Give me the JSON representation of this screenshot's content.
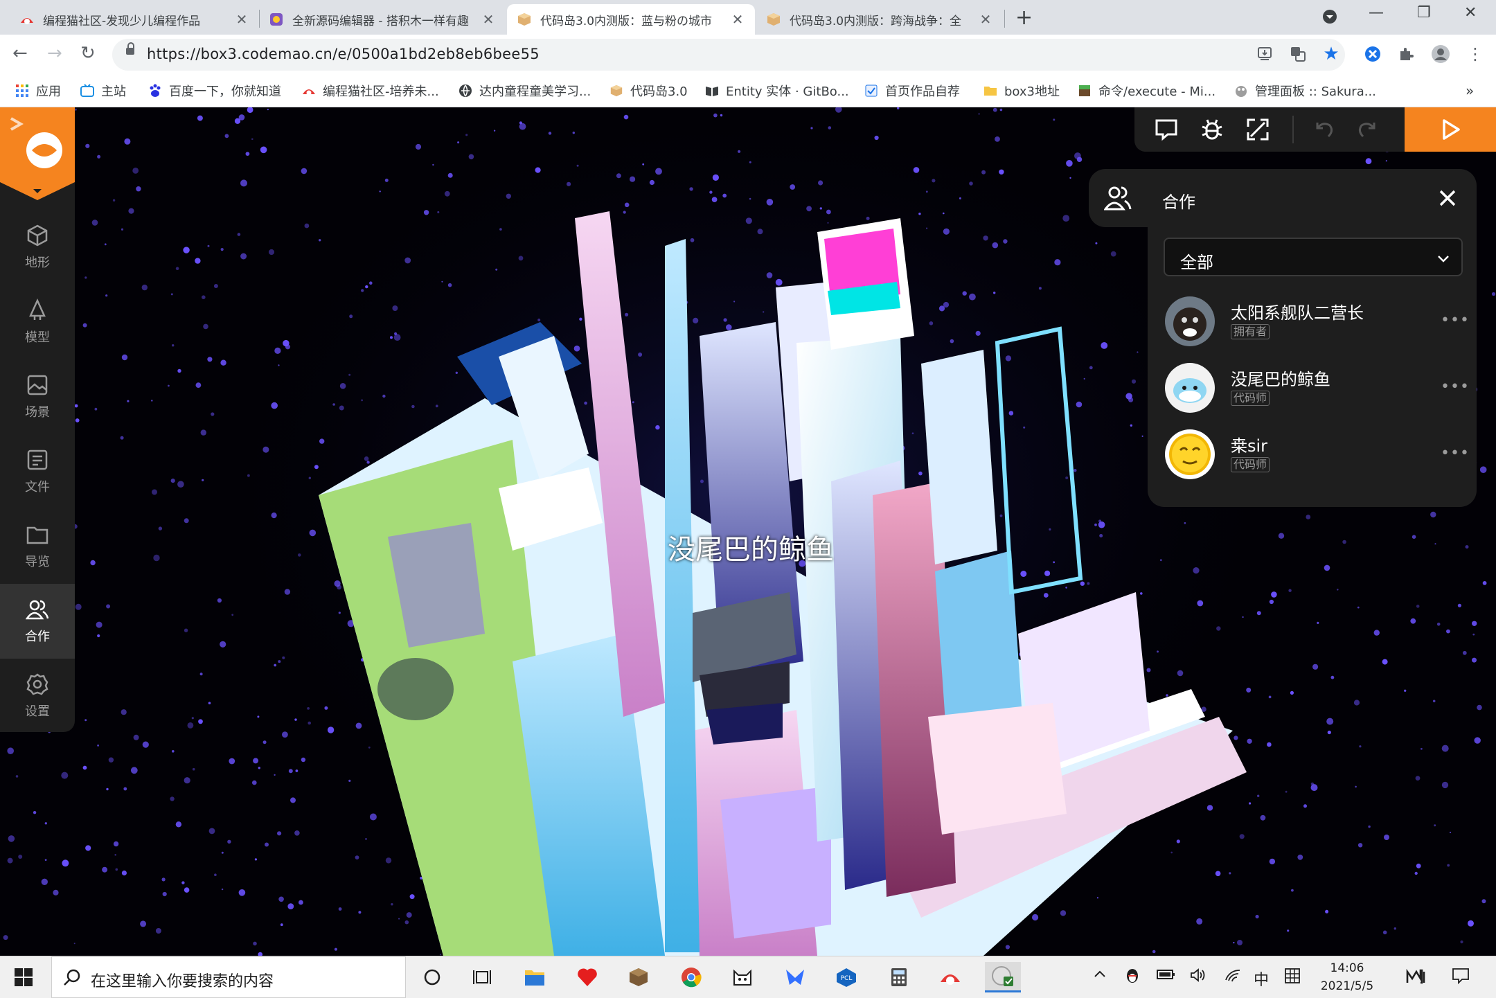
{
  "browser": {
    "tabs": [
      {
        "title": "编程猫社区-发现少儿编程作品",
        "favicon": "codemao-cat-icon",
        "active": false
      },
      {
        "title": "全新源码编辑器 - 搭积木一样有趣",
        "favicon": "kitten-editor-icon",
        "active": false
      },
      {
        "title": "代码岛3.0内测版：蓝与粉の城市",
        "favicon": "box3-cube-icon",
        "active": true
      },
      {
        "title": "代码岛3.0内测版：跨海战争：全",
        "favicon": "box3-cube-icon",
        "active": false
      }
    ],
    "url": "https://box3.codemao.cn/e/0500a1bd2eb8eb6bee55",
    "bookmarks": [
      "应用",
      "主站",
      "百度一下，你就知道",
      "编程猫社区-培养未...",
      "达内童程童美学习...",
      "代码岛3.0",
      "Entity 实体 · GitBo...",
      "首页作品自荐",
      "box3地址",
      "命令/execute - Mi...",
      "管理面板 :: Sakura..."
    ],
    "bookmarks_more": "»"
  },
  "sidebar": {
    "items": [
      {
        "label": "地形",
        "icon": "cube-icon"
      },
      {
        "label": "模型",
        "icon": "model-icon"
      },
      {
        "label": "场景",
        "icon": "image-icon"
      },
      {
        "label": "文件",
        "icon": "file-list-icon"
      },
      {
        "label": "导览",
        "icon": "folder-icon"
      },
      {
        "label": "合作",
        "icon": "people-icon",
        "active": true
      },
      {
        "label": "设置",
        "icon": "gear-icon"
      }
    ]
  },
  "scene": {
    "player_nametag": "没尾巴的鲸鱼"
  },
  "collab": {
    "title": "合作",
    "filter": "全部",
    "members": [
      {
        "name": "太阳系舰队二营长",
        "role": "拥有者"
      },
      {
        "name": "没尾巴的鲸鱼",
        "role": "代码师"
      },
      {
        "name": "桒sir",
        "role": "代码师"
      }
    ],
    "more": "•••"
  },
  "taskbar": {
    "search_placeholder": "在这里输入你要搜索的内容",
    "ime": "中",
    "time": "14:06",
    "date": "2021/5/5"
  },
  "colors": {
    "accent": "#f5841f",
    "panel": "#1e1e1e"
  }
}
